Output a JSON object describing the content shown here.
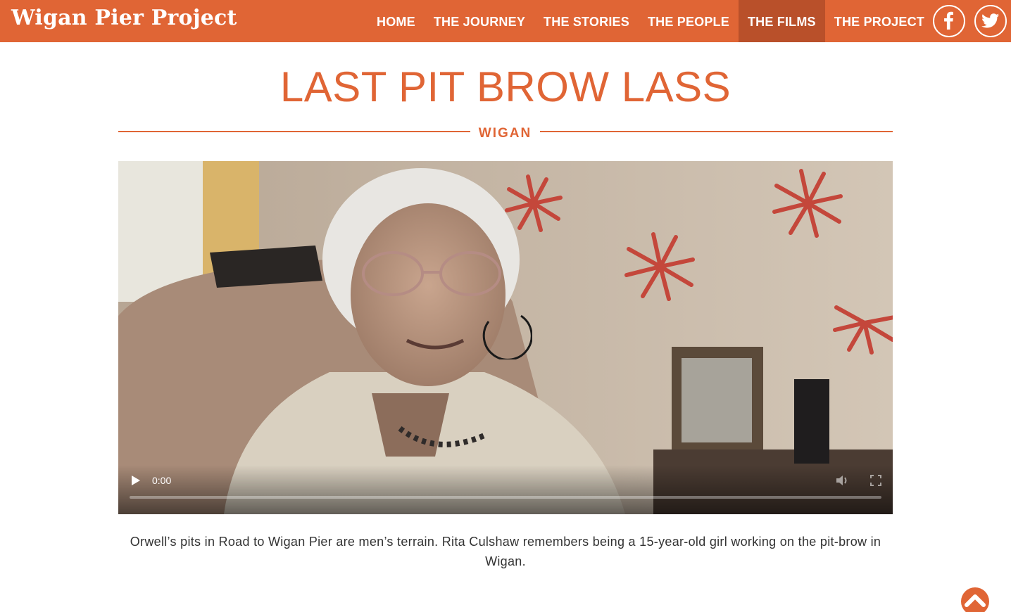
{
  "header": {
    "brand": "Wigan Pier Project",
    "nav": [
      {
        "label": "HOME",
        "active": false
      },
      {
        "label": "THE JOURNEY",
        "active": false
      },
      {
        "label": "THE STORIES",
        "active": false
      },
      {
        "label": "THE PEOPLE",
        "active": false
      },
      {
        "label": "THE FILMS",
        "active": true
      },
      {
        "label": "THE PROJECT",
        "active": false
      }
    ],
    "social": [
      {
        "icon": "facebook-icon"
      },
      {
        "icon": "twitter-icon"
      }
    ]
  },
  "page": {
    "title": "LAST PIT BROW LASS",
    "location": "WIGAN"
  },
  "video": {
    "time": "0:00",
    "state": "loading"
  },
  "caption": "Orwell’s pits in Road to Wigan Pier are men’s terrain. Rita Culshaw remembers being a 15-year-old girl working on the pit-brow in Wigan.",
  "colors": {
    "accent": "#e06535",
    "accent_dark": "#b9502a",
    "text": "#333333"
  },
  "icons": {
    "back_to_top": "chevron-up-icon",
    "play": "play-icon",
    "volume": "volume-icon",
    "fullscreen": "fullscreen-icon",
    "loading": "spinner-icon"
  }
}
